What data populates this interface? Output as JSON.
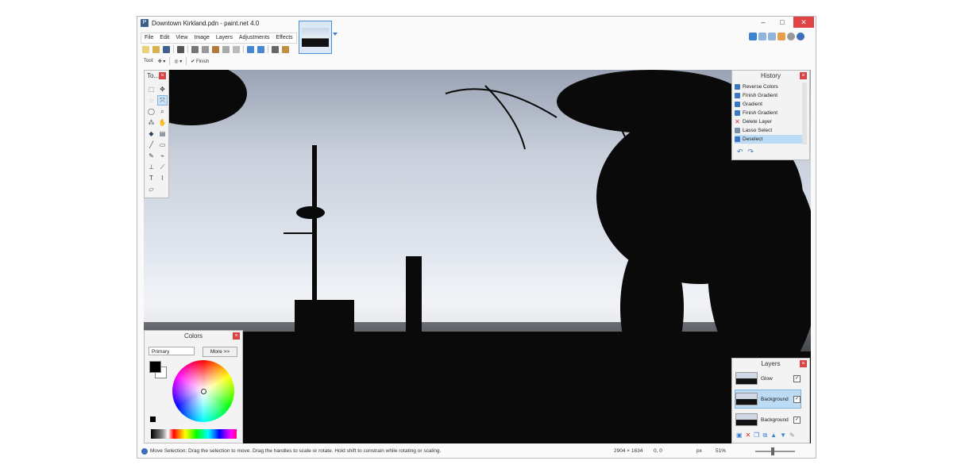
{
  "window": {
    "title": "Downtown Kirkland.pdn - paint.net 4.0"
  },
  "menu": [
    "File",
    "Edit",
    "View",
    "Image",
    "Layers",
    "Adjustments",
    "Effects"
  ],
  "toolbar": {
    "tool_label": "Tool:",
    "finish_label": "Finish"
  },
  "panels": {
    "tools": {
      "title": "To..."
    },
    "history": {
      "title": "History",
      "items": [
        {
          "label": "Reverse Colors",
          "icon": "history-icon"
        },
        {
          "label": "Finish Gradient",
          "icon": "history-icon"
        },
        {
          "label": "Gradient",
          "icon": "history-icon"
        },
        {
          "label": "Finish Gradient",
          "icon": "history-icon"
        },
        {
          "label": "Delete Layer",
          "icon": "delete-icon"
        },
        {
          "label": "Lasso Select",
          "icon": "lasso-icon"
        },
        {
          "label": "Deselect",
          "icon": "history-icon",
          "selected": true
        }
      ]
    },
    "colors": {
      "title": "Colors",
      "mode": "Primary",
      "more": "More >>"
    },
    "layers": {
      "title": "Layers",
      "items": [
        {
          "name": "Glow",
          "visible": true
        },
        {
          "name": "Background",
          "visible": true,
          "selected": true
        },
        {
          "name": "Background",
          "visible": true
        }
      ]
    }
  },
  "status": {
    "message": "Move Selection: Drag the selection to move. Drag the handles to scale or rotate. Hold shift to constrain while rotating or scaling.",
    "image_size": "2904 × 1634",
    "cursor_pos": "0, 0",
    "unit": "px",
    "zoom": "51%"
  },
  "colors": {
    "accent": "#3b82d4",
    "close": "#d94545",
    "selection": "#bcdcf5"
  }
}
